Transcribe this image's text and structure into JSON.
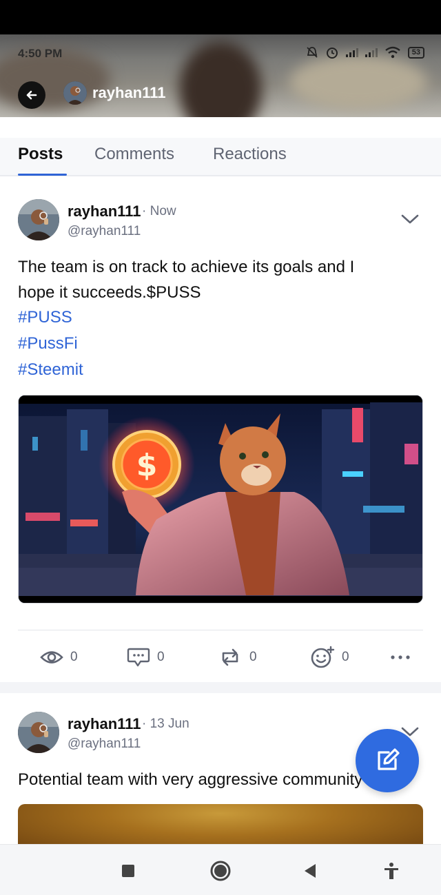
{
  "status_bar": {
    "time": "4:50 PM",
    "battery": "53"
  },
  "header": {
    "username": "rayhan111"
  },
  "tabs": [
    {
      "label": "Posts",
      "active": true
    },
    {
      "label": "Comments",
      "active": false
    },
    {
      "label": "Reactions",
      "active": false
    }
  ],
  "posts": [
    {
      "author": "rayhan111",
      "time": "· Now",
      "handle": "@rayhan111",
      "text_line1": "The team is on track to achieve its goals and I",
      "text_line2": "hope it succeeds.$PUSS",
      "hashtags": [
        "#PUSS",
        "#PussFi",
        "#Steemit"
      ],
      "actions": {
        "views": "0",
        "comments": "0",
        "reposts": "0",
        "reactions": "0"
      }
    },
    {
      "author": "rayhan111",
      "time": "· 13 Jun",
      "handle": "@rayhan111",
      "text_line1": "Potential team with very aggressive community"
    }
  ],
  "colors": {
    "accent": "#2f64d6",
    "fab": "#2f6be0"
  },
  "icons": {
    "back": "arrow-left-icon",
    "chevron": "chevron-down-icon",
    "views": "eye-icon",
    "comments": "comment-icon",
    "reposts": "repost-icon",
    "reactions": "add-reaction-icon",
    "more": "more-horizontal-icon",
    "compose": "edit-icon",
    "nav": [
      "square-icon",
      "circle-icon",
      "back-triangle-icon",
      "accessibility-icon"
    ]
  }
}
